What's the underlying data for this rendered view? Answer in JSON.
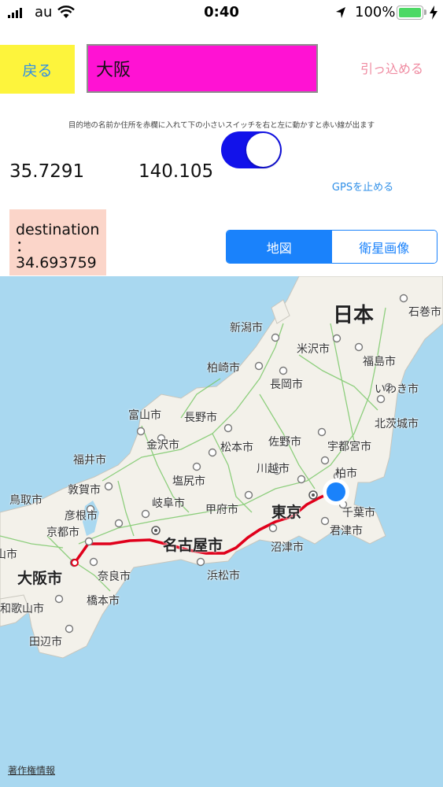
{
  "status_bar": {
    "carrier": "au",
    "time": "0:40",
    "battery_percent": "100%",
    "icons": [
      "signal-icon",
      "wifi-icon",
      "location-arrow-icon",
      "battery-icon",
      "charging-bolt-icon"
    ]
  },
  "controls": {
    "back_label": "戻る",
    "destination_value": "大阪",
    "retract_label": "引っ込める",
    "help_text": "目的地の名前か住所を赤欄に入れて下の小さいスイッチを右と左に動かすと赤い線が出ます",
    "current_lat": "35.7291",
    "current_lon": "140.105",
    "route_switch_on": true,
    "gps_stop_label": "GPSを止める",
    "destination_line1": "destination",
    "destination_line2": "：",
    "destination_line3": "34.693759"
  },
  "map_type": {
    "selected": "地図",
    "options": [
      "地図",
      "衛星画像"
    ]
  },
  "map": {
    "country_label": "日本",
    "cities": [
      "石巻市",
      "新潟市",
      "米沢市",
      "福島市",
      "柏崎市",
      "長岡市",
      "いわき市",
      "富山市",
      "長野市",
      "北茨城市",
      "金沢市",
      "佐野市",
      "宇都宮市",
      "福井市",
      "松本市",
      "川越市",
      "塩尻市",
      "柏市",
      "敦賀市",
      "鳥取市",
      "彦根市",
      "岐阜市",
      "甲府市",
      "東京",
      "千葉市",
      "京都市",
      "君津市",
      "名古屋市",
      "沼津市",
      "大阪市",
      "奈良市",
      "浜松市",
      "和歌山市",
      "橋本市",
      "田辺市",
      "岡山市"
    ],
    "attribution": "著作権情報",
    "colors": {
      "water": "#a9d8f0",
      "land": "#f3f1ea",
      "roads": "#7cc96a",
      "route": "#e0001b",
      "user_location": "#1a82fb"
    }
  }
}
